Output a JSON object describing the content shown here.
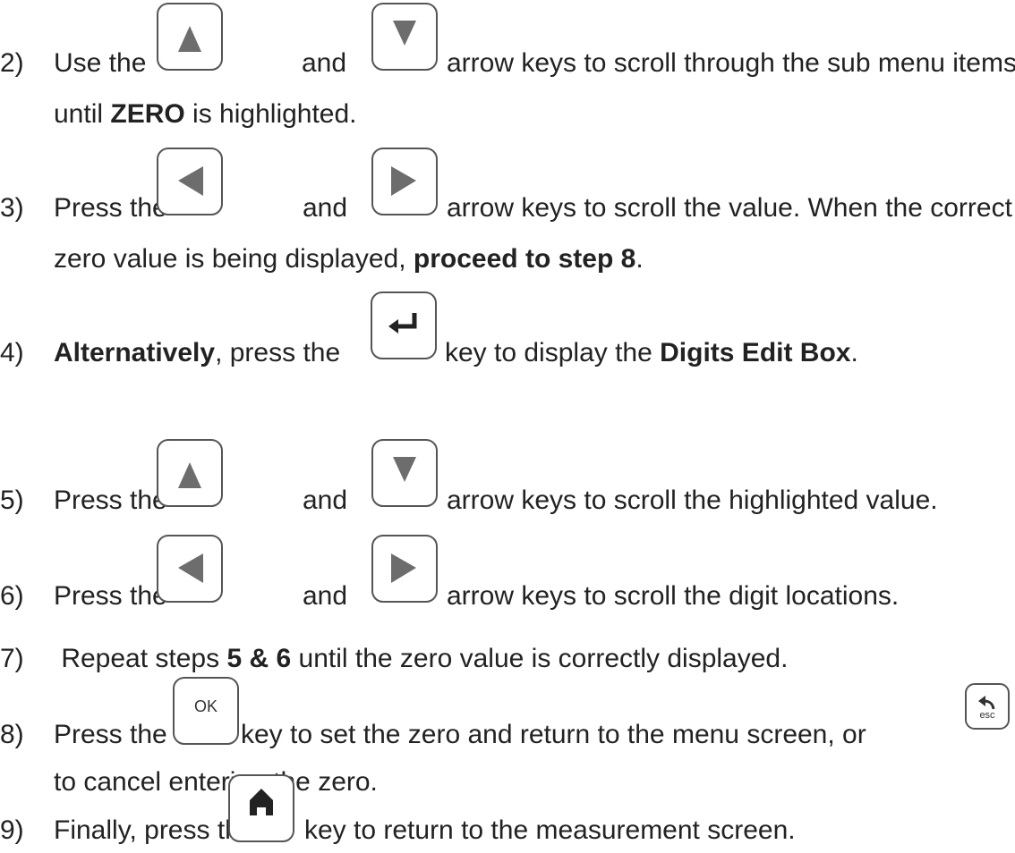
{
  "steps": [
    {
      "num": "2)",
      "pre": "Use the",
      "mid": "and",
      "post": "arrow keys to scroll through the sub menu items",
      "cont": {
        "a": "until ",
        "b": "ZERO",
        "c": " is highlighted."
      }
    },
    {
      "num": "3)",
      "pre": "Press the",
      "mid": "and",
      "post": "arrow keys to scroll the value.  When the correct",
      "cont": {
        "a": "zero value is being displayed, ",
        "b": "proceed to step 8",
        "c": "."
      }
    },
    {
      "num": "4)",
      "bold_pre": "Alternatively",
      "pre": ", press the",
      "post_a": "key to display the ",
      "post_b": "Digits Edit Box",
      "post_c": "."
    },
    {
      "num": "5)",
      "pre": "Press the",
      "mid": "and",
      "post": "arrow keys to scroll the highlighted value."
    },
    {
      "num": "6)",
      "pre": "Press the",
      "mid": "and",
      "post": "arrow keys to scroll the digit locations."
    },
    {
      "num": "7)",
      "a": " Repeat steps ",
      "b": "5 & 6",
      "c": " until the zero value is correctly displayed."
    },
    {
      "num": "8)",
      "pre": "Press the",
      "post": "key to set the zero and return to the menu screen, or",
      "cont": "to cancel entering the zero."
    },
    {
      "num": "9)",
      "pre": "Finally, press the",
      "post": "key to return to the measurement screen."
    }
  ],
  "keys": {
    "ok_label": "OK",
    "esc_label": "esc",
    "icons": [
      "up-arrow-icon",
      "down-arrow-icon",
      "left-arrow-icon",
      "right-arrow-icon",
      "enter-icon",
      "back-icon",
      "home-icon"
    ]
  }
}
